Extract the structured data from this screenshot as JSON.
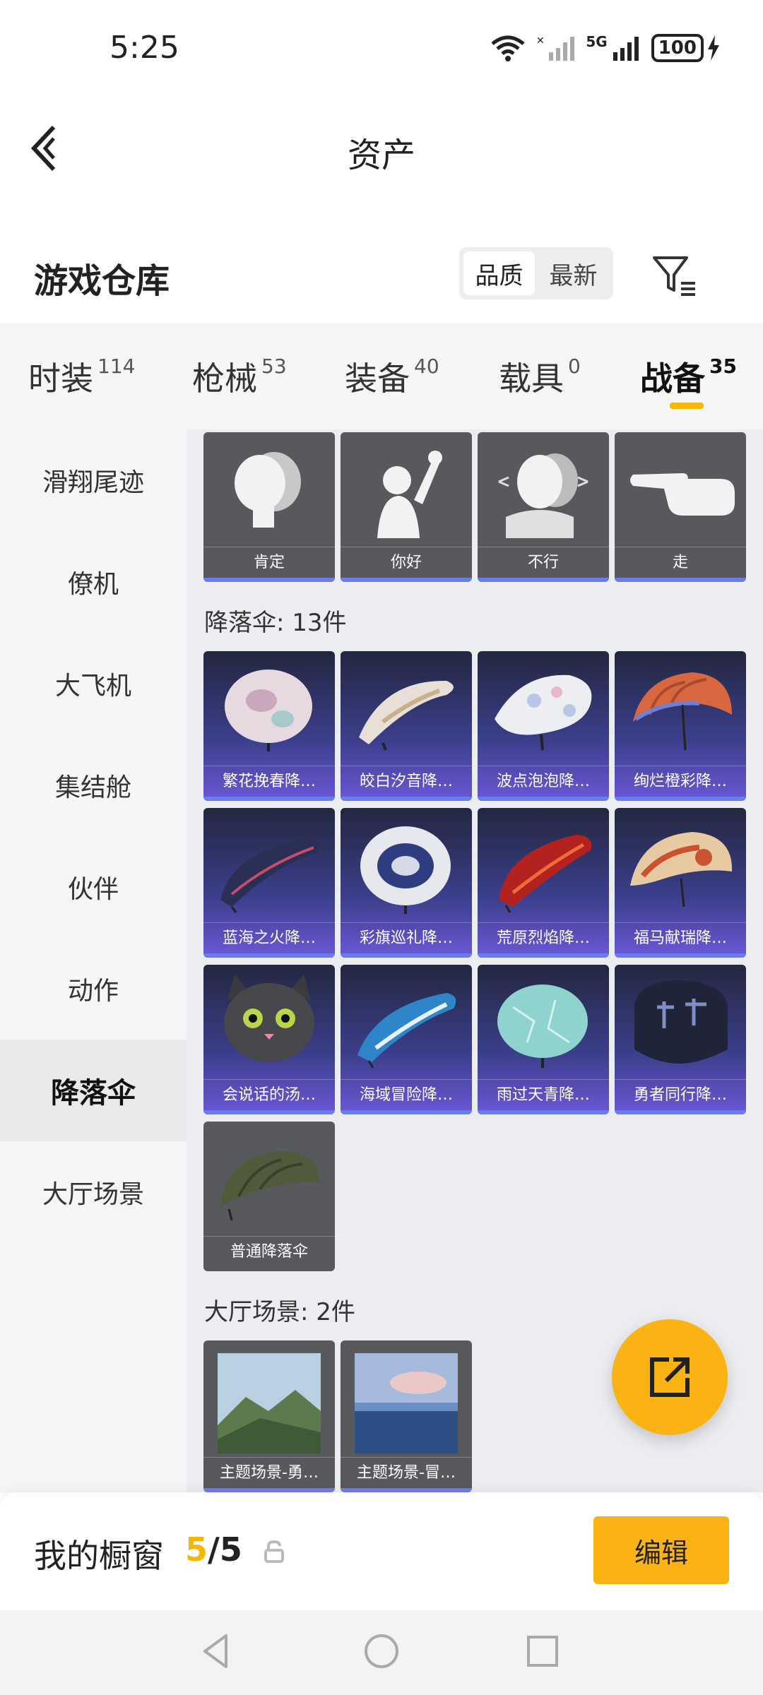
{
  "status_bar": {
    "time": "5:25",
    "battery": "100",
    "network": "5G"
  },
  "header": {
    "title": "资产"
  },
  "inventory": {
    "title": "游戏仓库",
    "sort_options": [
      "品质",
      "最新"
    ],
    "active_sort": "品质"
  },
  "tabs": [
    {
      "label": "时装",
      "count": "114"
    },
    {
      "label": "枪械",
      "count": "53"
    },
    {
      "label": "装备",
      "count": "40"
    },
    {
      "label": "载具",
      "count": "0"
    },
    {
      "label": "战备",
      "count": "35"
    }
  ],
  "active_tab": "战备",
  "sidebar": {
    "items": [
      "滑翔尾迹",
      "僚机",
      "大飞机",
      "集结舱",
      "伙伴",
      "动作",
      "降落伞",
      "大厅场景"
    ],
    "active": "降落伞"
  },
  "sections": {
    "actions": {
      "items": [
        "肯定",
        "你好",
        "不行",
        "走"
      ]
    },
    "parachutes": {
      "label": "降落伞: 13件",
      "items": [
        "繁花挽春降…",
        "皎白汐音降…",
        "波点泡泡降…",
        "绚烂橙彩降…",
        "蓝海之火降…",
        "彩旗巡礼降…",
        "荒原烈焰降…",
        "福马献瑞降…",
        "会说话的汤…",
        "海域冒险降…",
        "雨过天青降…",
        "勇者同行降…",
        "普通降落伞"
      ]
    },
    "lobby": {
      "label": "大厅场景: 2件",
      "items": [
        "主题场景-勇…",
        "主题场景-冒…"
      ]
    }
  },
  "window": {
    "label": "我的橱窗",
    "current": "5",
    "separator": "/",
    "total": "5",
    "edit_label": "编辑"
  },
  "colors": {
    "accent": "#fbb313",
    "card_edge": "#6b7cf0",
    "purple_card": "#3b3f8c"
  },
  "icons": [
    "back-arrow-icon",
    "filter-icon",
    "lock-icon",
    "share-icon",
    "wifi-icon",
    "signal-icon",
    "battery-icon",
    "charging-icon"
  ]
}
